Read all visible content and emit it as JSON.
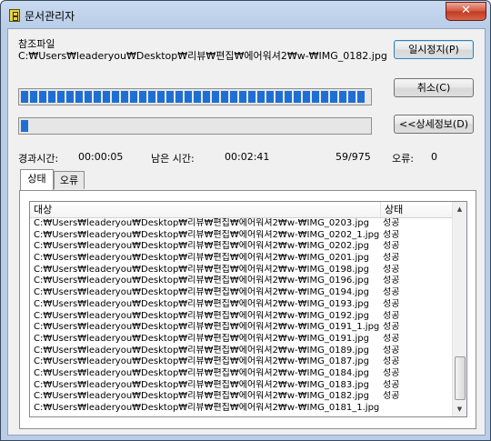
{
  "window": {
    "title": "문서관리자",
    "close_label": "✕"
  },
  "main": {
    "file_label": "참조파일",
    "file_path": "C:₩Users₩leaderyou₩Desktop₩리뷰₩편집₩에어워셔2₩w-₩IMG_0182.jpg",
    "progress_file": 0.99,
    "progress_total": 0.025
  },
  "buttons": {
    "pause": "일시정지(P)",
    "cancel": "취소(C)",
    "details": "<<상세정보(D)"
  },
  "status": {
    "elapsed_label": "경과시간:",
    "elapsed_value": "00:00:05",
    "remaining_label": "남은 시간:",
    "remaining_value": "00:02:41",
    "count": "59/975",
    "error_label": "오류:",
    "error_value": "0"
  },
  "tabs": [
    "상태",
    "오류"
  ],
  "list": {
    "columns": [
      "대상",
      "상태"
    ],
    "rows": [
      [
        "C:₩Users₩leaderyou₩Desktop₩리뷰₩편집₩에어워셔2₩w-₩IMG_0203.jpg",
        "성공"
      ],
      [
        "C:₩Users₩leaderyou₩Desktop₩리뷰₩편집₩에어워셔2₩w-₩IMG_0202_1.jpg",
        "성공"
      ],
      [
        "C:₩Users₩leaderyou₩Desktop₩리뷰₩편집₩에어워셔2₩w-₩IMG_0202.jpg",
        "성공"
      ],
      [
        "C:₩Users₩leaderyou₩Desktop₩리뷰₩편집₩에어워셔2₩w-₩IMG_0201.jpg",
        "성공"
      ],
      [
        "C:₩Users₩leaderyou₩Desktop₩리뷰₩편집₩에어워셔2₩w-₩IMG_0198.jpg",
        "성공"
      ],
      [
        "C:₩Users₩leaderyou₩Desktop₩리뷰₩편집₩에어워셔2₩w-₩IMG_0196.jpg",
        "성공"
      ],
      [
        "C:₩Users₩leaderyou₩Desktop₩리뷰₩편집₩에어워셔2₩w-₩IMG_0194.jpg",
        "성공"
      ],
      [
        "C:₩Users₩leaderyou₩Desktop₩리뷰₩편집₩에어워셔2₩w-₩IMG_0193.jpg",
        "성공"
      ],
      [
        "C:₩Users₩leaderyou₩Desktop₩리뷰₩편집₩에어워셔2₩w-₩IMG_0192.jpg",
        "성공"
      ],
      [
        "C:₩Users₩leaderyou₩Desktop₩리뷰₩편집₩에어워셔2₩w-₩IMG_0191_1.jpg",
        "성공"
      ],
      [
        "C:₩Users₩leaderyou₩Desktop₩리뷰₩편집₩에어워셔2₩w-₩IMG_0191.jpg",
        "성공"
      ],
      [
        "C:₩Users₩leaderyou₩Desktop₩리뷰₩편집₩에어워셔2₩w-₩IMG_0189.jpg",
        "성공"
      ],
      [
        "C:₩Users₩leaderyou₩Desktop₩리뷰₩편집₩에어워셔2₩w-₩IMG_0187.jpg",
        "성공"
      ],
      [
        "C:₩Users₩leaderyou₩Desktop₩리뷰₩편집₩에어워셔2₩w-₩IMG_0184.jpg",
        "성공"
      ],
      [
        "C:₩Users₩leaderyou₩Desktop₩리뷰₩편집₩에어워셔2₩w-₩IMG_0183.jpg",
        "성공"
      ],
      [
        "C:₩Users₩leaderyou₩Desktop₩리뷰₩편집₩에어워셔2₩w-₩IMG_0182.jpg",
        "성공"
      ],
      [
        "C:₩Users₩leaderyou₩Desktop₩리뷰₩편집₩에어워셔2₩w-₩IMG_0181_1.jpg",
        ""
      ]
    ]
  },
  "icons": {
    "app": "file-manager-icon",
    "scroll_up": "▲",
    "scroll_down": "▼"
  },
  "colors": {
    "progress": "#1e6fd4",
    "title_bar": "#b9cde8",
    "close": "#c9442a"
  }
}
